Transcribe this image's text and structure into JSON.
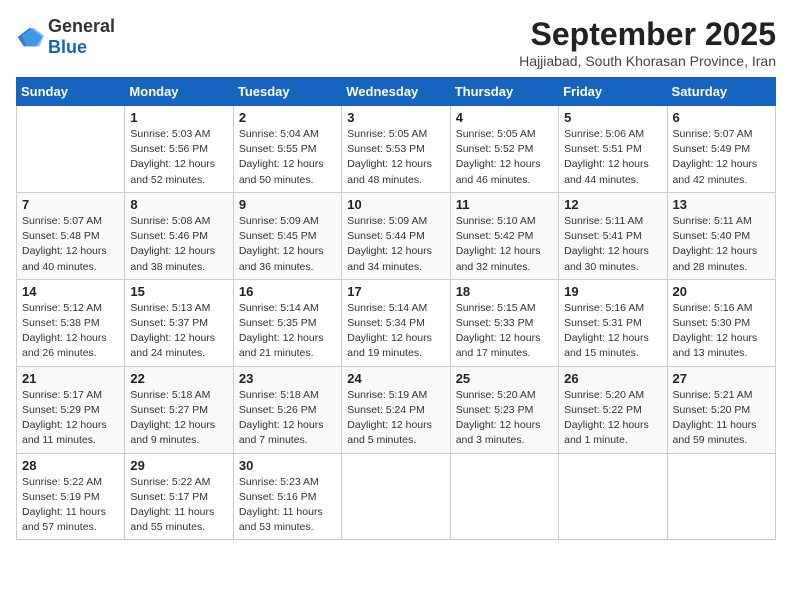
{
  "logo": {
    "text_general": "General",
    "text_blue": "Blue"
  },
  "title": "September 2025",
  "subtitle": "Hajjiabad, South Khorasan Province, Iran",
  "days_of_week": [
    "Sunday",
    "Monday",
    "Tuesday",
    "Wednesday",
    "Thursday",
    "Friday",
    "Saturday"
  ],
  "weeks": [
    [
      {
        "day": "",
        "info": ""
      },
      {
        "day": "1",
        "info": "Sunrise: 5:03 AM\nSunset: 5:56 PM\nDaylight: 12 hours\nand 52 minutes."
      },
      {
        "day": "2",
        "info": "Sunrise: 5:04 AM\nSunset: 5:55 PM\nDaylight: 12 hours\nand 50 minutes."
      },
      {
        "day": "3",
        "info": "Sunrise: 5:05 AM\nSunset: 5:53 PM\nDaylight: 12 hours\nand 48 minutes."
      },
      {
        "day": "4",
        "info": "Sunrise: 5:05 AM\nSunset: 5:52 PM\nDaylight: 12 hours\nand 46 minutes."
      },
      {
        "day": "5",
        "info": "Sunrise: 5:06 AM\nSunset: 5:51 PM\nDaylight: 12 hours\nand 44 minutes."
      },
      {
        "day": "6",
        "info": "Sunrise: 5:07 AM\nSunset: 5:49 PM\nDaylight: 12 hours\nand 42 minutes."
      }
    ],
    [
      {
        "day": "7",
        "info": "Sunrise: 5:07 AM\nSunset: 5:48 PM\nDaylight: 12 hours\nand 40 minutes."
      },
      {
        "day": "8",
        "info": "Sunrise: 5:08 AM\nSunset: 5:46 PM\nDaylight: 12 hours\nand 38 minutes."
      },
      {
        "day": "9",
        "info": "Sunrise: 5:09 AM\nSunset: 5:45 PM\nDaylight: 12 hours\nand 36 minutes."
      },
      {
        "day": "10",
        "info": "Sunrise: 5:09 AM\nSunset: 5:44 PM\nDaylight: 12 hours\nand 34 minutes."
      },
      {
        "day": "11",
        "info": "Sunrise: 5:10 AM\nSunset: 5:42 PM\nDaylight: 12 hours\nand 32 minutes."
      },
      {
        "day": "12",
        "info": "Sunrise: 5:11 AM\nSunset: 5:41 PM\nDaylight: 12 hours\nand 30 minutes."
      },
      {
        "day": "13",
        "info": "Sunrise: 5:11 AM\nSunset: 5:40 PM\nDaylight: 12 hours\nand 28 minutes."
      }
    ],
    [
      {
        "day": "14",
        "info": "Sunrise: 5:12 AM\nSunset: 5:38 PM\nDaylight: 12 hours\nand 26 minutes."
      },
      {
        "day": "15",
        "info": "Sunrise: 5:13 AM\nSunset: 5:37 PM\nDaylight: 12 hours\nand 24 minutes."
      },
      {
        "day": "16",
        "info": "Sunrise: 5:14 AM\nSunset: 5:35 PM\nDaylight: 12 hours\nand 21 minutes."
      },
      {
        "day": "17",
        "info": "Sunrise: 5:14 AM\nSunset: 5:34 PM\nDaylight: 12 hours\nand 19 minutes."
      },
      {
        "day": "18",
        "info": "Sunrise: 5:15 AM\nSunset: 5:33 PM\nDaylight: 12 hours\nand 17 minutes."
      },
      {
        "day": "19",
        "info": "Sunrise: 5:16 AM\nSunset: 5:31 PM\nDaylight: 12 hours\nand 15 minutes."
      },
      {
        "day": "20",
        "info": "Sunrise: 5:16 AM\nSunset: 5:30 PM\nDaylight: 12 hours\nand 13 minutes."
      }
    ],
    [
      {
        "day": "21",
        "info": "Sunrise: 5:17 AM\nSunset: 5:29 PM\nDaylight: 12 hours\nand 11 minutes."
      },
      {
        "day": "22",
        "info": "Sunrise: 5:18 AM\nSunset: 5:27 PM\nDaylight: 12 hours\nand 9 minutes."
      },
      {
        "day": "23",
        "info": "Sunrise: 5:18 AM\nSunset: 5:26 PM\nDaylight: 12 hours\nand 7 minutes."
      },
      {
        "day": "24",
        "info": "Sunrise: 5:19 AM\nSunset: 5:24 PM\nDaylight: 12 hours\nand 5 minutes."
      },
      {
        "day": "25",
        "info": "Sunrise: 5:20 AM\nSunset: 5:23 PM\nDaylight: 12 hours\nand 3 minutes."
      },
      {
        "day": "26",
        "info": "Sunrise: 5:20 AM\nSunset: 5:22 PM\nDaylight: 12 hours\nand 1 minute."
      },
      {
        "day": "27",
        "info": "Sunrise: 5:21 AM\nSunset: 5:20 PM\nDaylight: 11 hours\nand 59 minutes."
      }
    ],
    [
      {
        "day": "28",
        "info": "Sunrise: 5:22 AM\nSunset: 5:19 PM\nDaylight: 11 hours\nand 57 minutes."
      },
      {
        "day": "29",
        "info": "Sunrise: 5:22 AM\nSunset: 5:17 PM\nDaylight: 11 hours\nand 55 minutes."
      },
      {
        "day": "30",
        "info": "Sunrise: 5:23 AM\nSunset: 5:16 PM\nDaylight: 11 hours\nand 53 minutes."
      },
      {
        "day": "",
        "info": ""
      },
      {
        "day": "",
        "info": ""
      },
      {
        "day": "",
        "info": ""
      },
      {
        "day": "",
        "info": ""
      }
    ]
  ]
}
